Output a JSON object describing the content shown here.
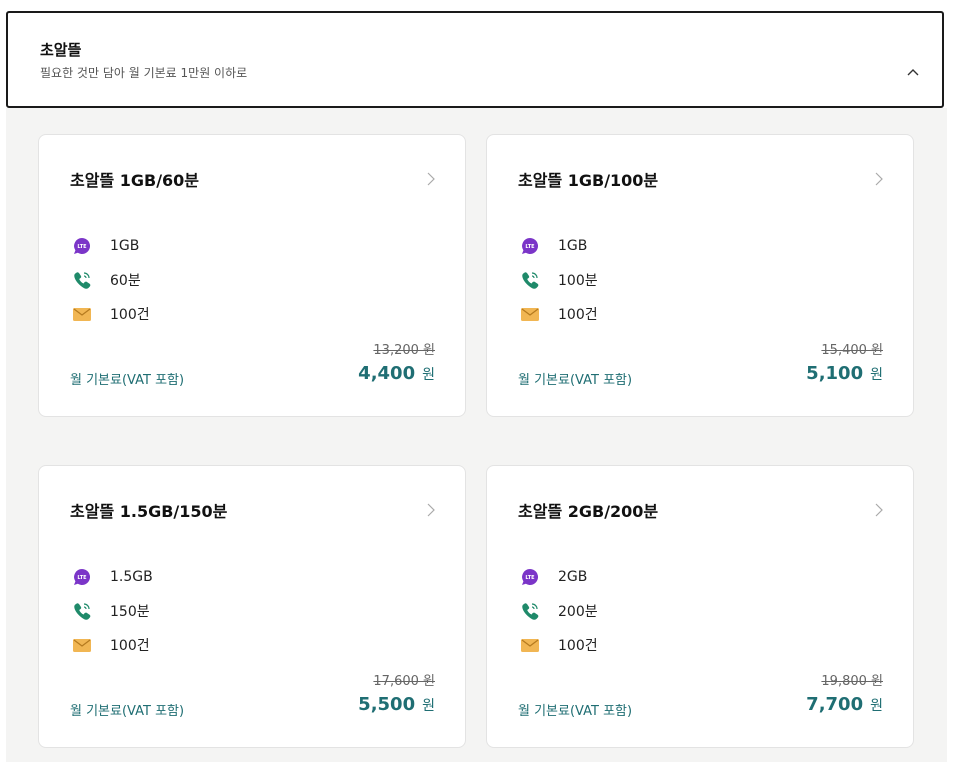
{
  "header": {
    "title": "초알뜰",
    "subtitle": "필요한 것만 담아 월 기본료 1만원 이하로",
    "icon": "chevron-up-icon"
  },
  "colors": {
    "accent": "#1f6e73",
    "data_icon": "#7b35c8",
    "call_icon": "#1f8a6a",
    "sms_icon": "#f1b653"
  },
  "plans": [
    {
      "name": "초알뜰 1GB/60분",
      "data": "1GB",
      "voice": "60분",
      "sms": "100건",
      "data_badge": "LTE",
      "original_price": "13,200 원",
      "fee_label": "월 기본료(VAT 포함)",
      "price": "4,400",
      "currency": "원"
    },
    {
      "name": "초알뜰 1GB/100분",
      "data": "1GB",
      "voice": "100분",
      "sms": "100건",
      "data_badge": "LTE",
      "original_price": "15,400 원",
      "fee_label": "월 기본료(VAT 포함)",
      "price": "5,100",
      "currency": "원"
    },
    {
      "name": "초알뜰 1.5GB/150분",
      "data": "1.5GB",
      "voice": "150분",
      "sms": "100건",
      "data_badge": "LTE",
      "original_price": "17,600 원",
      "fee_label": "월 기본료(VAT 포함)",
      "price": "5,500",
      "currency": "원"
    },
    {
      "name": "초알뜰 2GB/200분",
      "data": "2GB",
      "voice": "200분",
      "sms": "100건",
      "data_badge": "LTE",
      "original_price": "19,800 원",
      "fee_label": "월 기본료(VAT 포함)",
      "price": "7,700",
      "currency": "원"
    }
  ]
}
